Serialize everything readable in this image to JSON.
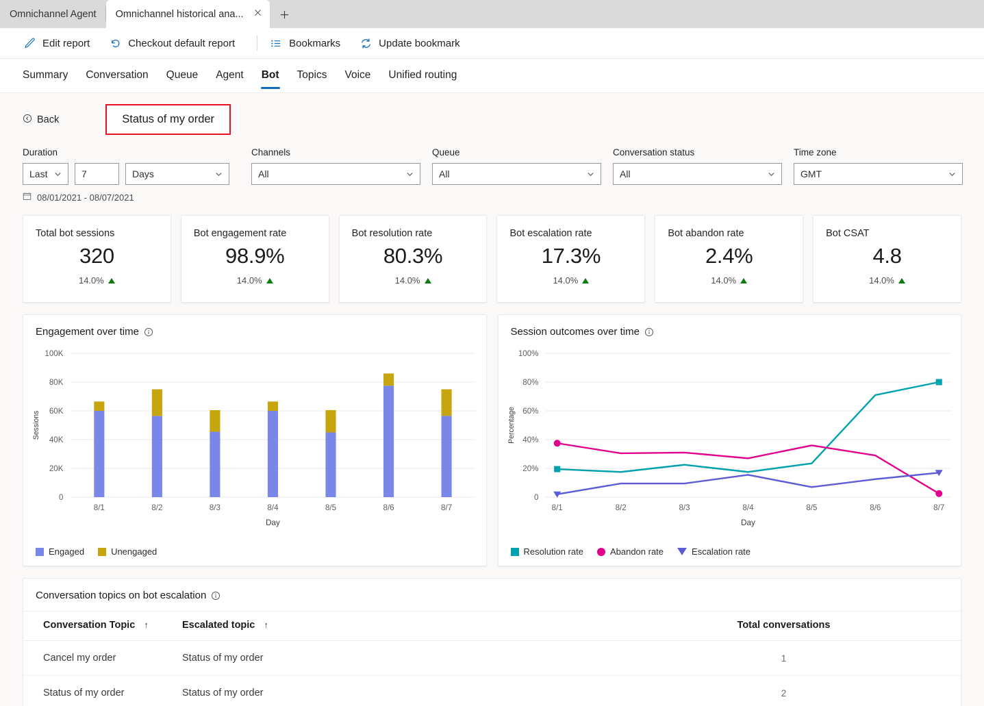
{
  "browser": {
    "tabs": [
      {
        "title": "Omnichannel Agent",
        "active": false
      },
      {
        "title": "Omnichannel historical ana...",
        "active": true
      }
    ],
    "close_icon": "close-icon",
    "new_tab_icon": "plus-icon"
  },
  "commandbar": {
    "items": [
      {
        "label": "Edit report",
        "icon": "pencil-icon"
      },
      {
        "label": "Checkout default report",
        "icon": "undo-icon"
      },
      {
        "label": "Bookmarks",
        "icon": "list-icon"
      },
      {
        "label": "Update bookmark",
        "icon": "refresh-icon"
      }
    ]
  },
  "nav": {
    "tabs": [
      {
        "label": "Summary",
        "selected": false
      },
      {
        "label": "Conversation",
        "selected": false
      },
      {
        "label": "Queue",
        "selected": false
      },
      {
        "label": "Agent",
        "selected": false
      },
      {
        "label": "Bot",
        "selected": true
      },
      {
        "label": "Topics",
        "selected": false
      },
      {
        "label": "Voice",
        "selected": false
      },
      {
        "label": "Unified routing",
        "selected": false
      }
    ]
  },
  "header": {
    "back_label": "Back",
    "back_icon": "back-circle-icon",
    "report_name": "Status of my order",
    "highlight_color": "#e81123"
  },
  "filters": {
    "duration": {
      "label": "Duration",
      "mode": "Last",
      "amount": "7",
      "unit": "Days"
    },
    "channels": {
      "label": "Channels",
      "value": "All"
    },
    "queue": {
      "label": "Queue",
      "value": "All"
    },
    "conversation_status": {
      "label": "Conversation status",
      "value": "All"
    },
    "time_zone": {
      "label": "Time zone",
      "value": "GMT"
    },
    "date_range": "08/01/2021 - 08/07/2021",
    "calendar_icon": "calendar-icon"
  },
  "kpis": [
    {
      "title": "Total bot sessions",
      "value": "320",
      "delta": "14.0%",
      "trend": "up"
    },
    {
      "title": "Bot engagement rate",
      "value": "98.9%",
      "delta": "14.0%",
      "trend": "up"
    },
    {
      "title": "Bot resolution rate",
      "value": "80.3%",
      "delta": "14.0%",
      "trend": "up"
    },
    {
      "title": "Bot escalation rate",
      "value": "17.3%",
      "delta": "14.0%",
      "trend": "up"
    },
    {
      "title": "Bot abandon rate",
      "value": "2.4%",
      "delta": "14.0%",
      "trend": "up"
    },
    {
      "title": "Bot CSAT",
      "value": "4.8",
      "delta": "14.0%",
      "trend": "up"
    }
  ],
  "chart_data": [
    {
      "type": "bar",
      "title": "Engagement over time",
      "stacked": true,
      "categories": [
        "8/1",
        "8/2",
        "8/3",
        "8/4",
        "8/5",
        "8/6",
        "8/7"
      ],
      "series": [
        {
          "name": "Engaged",
          "color": "#7988e8",
          "values": [
            60000,
            56500,
            45500,
            60000,
            45000,
            77500,
            56500
          ]
        },
        {
          "name": "Unengaged",
          "color": "#c6a50e",
          "values": [
            6500,
            18500,
            15000,
            6500,
            15500,
            8500,
            18500
          ]
        }
      ],
      "xlabel": "Day",
      "ylabel": "Sessions",
      "ylim": [
        0,
        100000
      ],
      "yticks": [
        "0",
        "20K",
        "40K",
        "60K",
        "80K",
        "100K"
      ],
      "ytick_values": [
        0,
        20000,
        40000,
        60000,
        80000,
        100000
      ],
      "grid": true,
      "legend_position": "bottom-left"
    },
    {
      "type": "line",
      "title": "Session outcomes over time",
      "categories": [
        "8/1",
        "8/2",
        "8/3",
        "8/4",
        "8/5",
        "8/6",
        "8/7"
      ],
      "series": [
        {
          "name": "Resolution rate",
          "color": "#00a2ad",
          "marker": "square",
          "values": [
            19.5,
            17.5,
            22.5,
            17.5,
            23.5,
            71,
            80
          ]
        },
        {
          "name": "Abandon rate",
          "color": "#e3008c",
          "marker": "circle",
          "values": [
            37.5,
            30.5,
            31,
            27,
            36,
            29,
            2.5
          ]
        },
        {
          "name": "Escalation rate",
          "color": "#5c5cd6",
          "marker": "triangle-down",
          "values": [
            2,
            9.5,
            9.5,
            15.5,
            7,
            12.5,
            17
          ]
        }
      ],
      "xlabel": "Day",
      "ylabel": "Percentage",
      "ylim": [
        0,
        100
      ],
      "yticks": [
        "0",
        "20%",
        "40%",
        "60%",
        "80%",
        "100%"
      ],
      "ytick_values": [
        0,
        20,
        40,
        60,
        80,
        100
      ],
      "grid": true,
      "legend_position": "bottom-left"
    }
  ],
  "table": {
    "title": "Conversation topics on bot escalation",
    "info_icon": "info-icon",
    "sort_icon": "sort-ascending-icon",
    "columns": [
      "Conversation Topic",
      "Escalated topic",
      "Total conversations"
    ],
    "rows": [
      {
        "topic": "Cancel my order",
        "escalated": "Status of my order",
        "total": "1"
      },
      {
        "topic": "Status of my order",
        "escalated": "Status of my order",
        "total": "2"
      }
    ]
  }
}
